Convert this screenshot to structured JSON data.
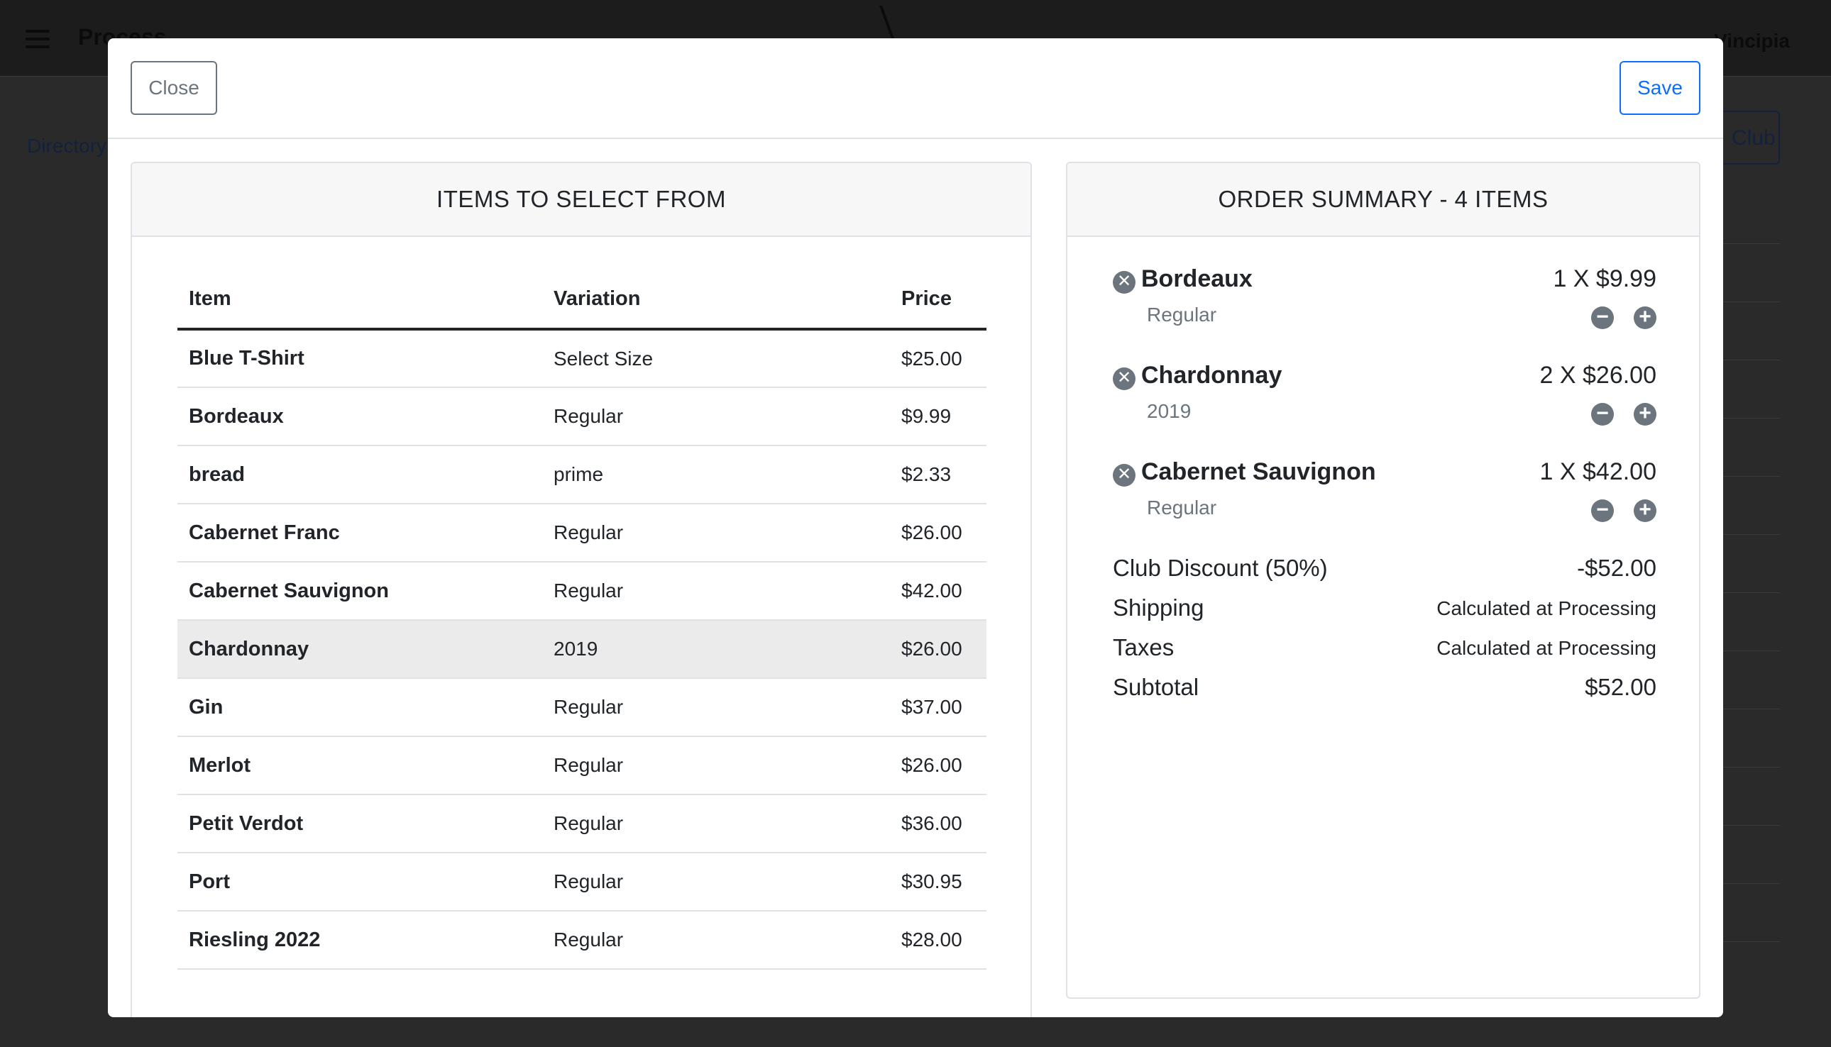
{
  "background": {
    "title": "Process",
    "right_text": "Vincipia",
    "directory_link": "Directory",
    "club_button": "Club"
  },
  "modal": {
    "close_label": "Close",
    "save_label": "Save"
  },
  "items_panel": {
    "title": "ITEMS TO SELECT FROM",
    "columns": [
      "Item",
      "Variation",
      "Price"
    ],
    "rows": [
      {
        "item": "Blue T-Shirt",
        "variation": "Select Size",
        "price": "$25.00"
      },
      {
        "item": "Bordeaux",
        "variation": "Regular",
        "price": "$9.99"
      },
      {
        "item": "bread",
        "variation": "prime",
        "price": "$2.33"
      },
      {
        "item": "Cabernet Franc",
        "variation": "Regular",
        "price": "$26.00"
      },
      {
        "item": "Cabernet Sauvignon",
        "variation": "Regular",
        "price": "$42.00"
      },
      {
        "item": "Chardonnay",
        "variation": "2019",
        "price": "$26.00"
      },
      {
        "item": "Gin",
        "variation": "Regular",
        "price": "$37.00"
      },
      {
        "item": "Merlot",
        "variation": "Regular",
        "price": "$26.00"
      },
      {
        "item": "Petit Verdot",
        "variation": "Regular",
        "price": "$36.00"
      },
      {
        "item": "Port",
        "variation": "Regular",
        "price": "$30.95"
      },
      {
        "item": "Riesling 2022",
        "variation": "Regular",
        "price": "$28.00"
      }
    ],
    "highlighted_row": "Chardonnay"
  },
  "order_summary": {
    "title": "ORDER SUMMARY - 4 ITEMS",
    "items": [
      {
        "name": "Bordeaux",
        "variation": "Regular",
        "qty_price": "1 X $9.99"
      },
      {
        "name": "Chardonnay",
        "variation": "2019",
        "qty_price": "2 X $26.00"
      },
      {
        "name": "Cabernet Sauvignon",
        "variation": "Regular",
        "qty_price": "1 X $42.00"
      }
    ],
    "totals": [
      {
        "label": "Club Discount (50%)",
        "value": "-$52.00"
      },
      {
        "label": "Shipping",
        "value": "Calculated at Processing"
      },
      {
        "label": "Taxes",
        "value": "Calculated at Processing"
      },
      {
        "label": "Subtotal",
        "value": "$52.00"
      }
    ]
  },
  "icons": {
    "remove": "✕",
    "minus": "−",
    "plus": "+"
  },
  "colors": {
    "primary": "#0d6efd",
    "secondary": "#6c757d",
    "highlight_row": "#ebebeb"
  }
}
